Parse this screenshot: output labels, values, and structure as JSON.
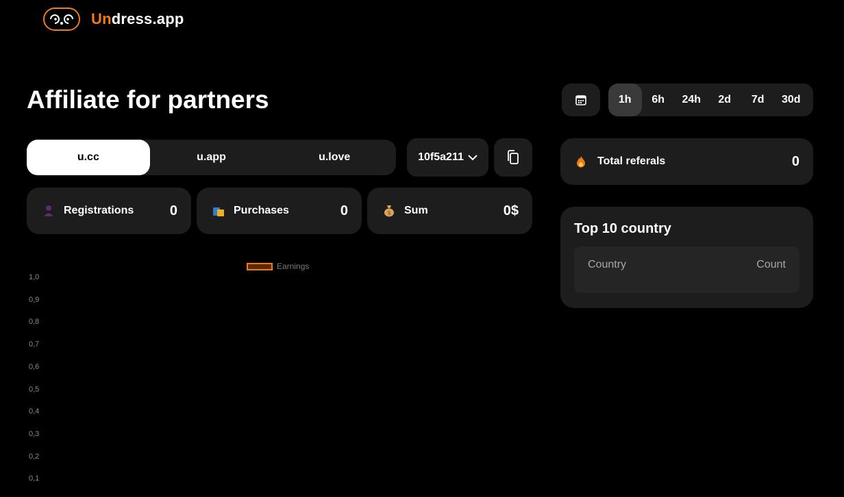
{
  "header": {
    "brand_accent": "Un",
    "brand_rest": "dress.app"
  },
  "page": {
    "title": "Affiliate for partners"
  },
  "domain_tabs": [
    {
      "label": "u.cc",
      "active": true
    },
    {
      "label": "u.app",
      "active": false
    },
    {
      "label": "u.love",
      "active": false
    }
  ],
  "ref_code": {
    "selected": "10f5a211"
  },
  "stats": {
    "registrations": {
      "label": "Registrations",
      "value": "0",
      "icon": "person-icon"
    },
    "purchases": {
      "label": "Purchases",
      "value": "0",
      "icon": "shopping-bags-icon"
    },
    "sum": {
      "label": "Sum",
      "value": "0$",
      "icon": "money-bag-icon"
    }
  },
  "time_ranges": [
    {
      "label": "1h",
      "active": true
    },
    {
      "label": "6h",
      "active": false
    },
    {
      "label": "24h",
      "active": false
    },
    {
      "label": "2d",
      "active": false
    },
    {
      "label": "7d",
      "active": false
    },
    {
      "label": "30d",
      "active": false
    }
  ],
  "referals": {
    "label": "Total referals",
    "value": "0",
    "icon": "fire-icon"
  },
  "top_countries": {
    "title": "Top 10 country",
    "col_country": "Country",
    "col_count": "Count"
  },
  "colors": {
    "accent": "#f07b17",
    "card_bg": "#1d1d1d",
    "page_bg": "#000000"
  },
  "chart_data": {
    "type": "bar",
    "legend": [
      "Earnings"
    ],
    "series": [
      {
        "name": "Earnings",
        "values": []
      }
    ],
    "yticks": [
      "1,0",
      "0,9",
      "0,8",
      "0,7",
      "0,6",
      "0,5",
      "0,4",
      "0,3",
      "0,2",
      "0,1"
    ],
    "ylim": [
      0,
      1
    ],
    "grid": false,
    "legend_placement": "top"
  }
}
